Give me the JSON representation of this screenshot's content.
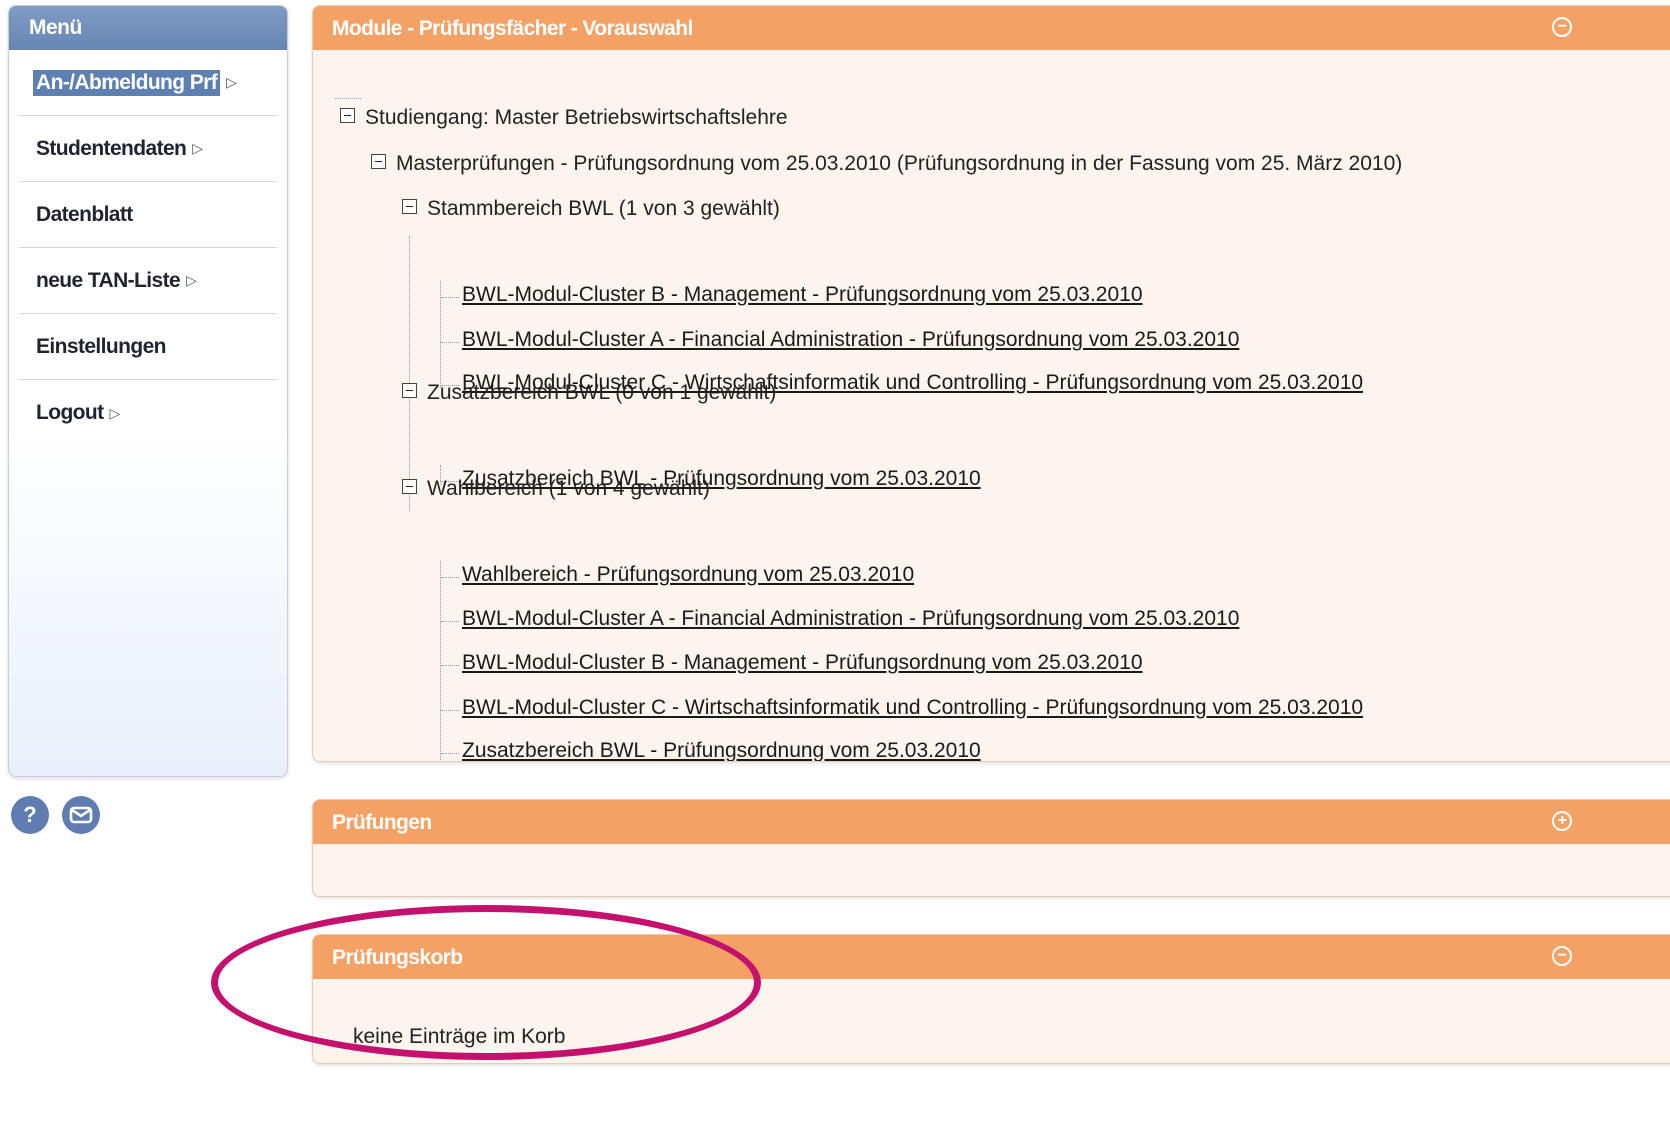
{
  "sidebar": {
    "title": "Menü",
    "items": [
      {
        "label": "An-/Abmeldung Prf",
        "arrow": "▷",
        "active": true
      },
      {
        "label": "Studentendaten",
        "arrow": "▷"
      },
      {
        "label": "Datenblatt",
        "arrow": ""
      },
      {
        "label": "neue TAN-Liste",
        "arrow": "▷"
      },
      {
        "label": "Einstellungen",
        "arrow": ""
      },
      {
        "label": "Logout",
        "arrow": "▷"
      }
    ],
    "help_icon_label": "?",
    "icons": [
      "help-icon",
      "mail-icon"
    ]
  },
  "panels": {
    "module": {
      "title": "Module - Prüfungsfächer - Vorauswahl",
      "toggle": "−",
      "tree": {
        "root": "Studiengang: Master Betriebswirtschaftslehre",
        "level1": "Masterprüfungen - Prüfungsordnung vom 25.03.2010 (Prüfungsordnung in der Fassung vom 25. März 2010)",
        "groups": [
          {
            "label": "Stammbereich BWL  (1 von 3 gewählt)",
            "items": [
              "BWL-Modul-Cluster B - Management - Prüfungsordnung vom 25.03.2010",
              "BWL-Modul-Cluster A - Financial Administration - Prüfungsordnung vom 25.03.2010",
              "BWL-Modul-Cluster C - Wirtschaftsinformatik und Controlling - Prüfungsordnung vom 25.03.2010"
            ]
          },
          {
            "label": "Zusatzbereich BWL  (0 von 1 gewählt)",
            "items": [
              "Zusatzbereich BWL - Prüfungsordnung vom 25.03.2010"
            ]
          },
          {
            "label": "Wahlbereich  (1 von 4 gewählt)",
            "items": [
              "Wahlbereich - Prüfungsordnung vom 25.03.2010",
              "BWL-Modul-Cluster A - Financial Administration - Prüfungsordnung vom 25.03.2010",
              "BWL-Modul-Cluster B - Management - Prüfungsordnung vom 25.03.2010",
              "BWL-Modul-Cluster C - Wirtschaftsinformatik und Controlling - Prüfungsordnung vom 25.03.2010",
              "Zusatzbereich BWL - Prüfungsordnung vom 25.03.2010"
            ]
          }
        ]
      }
    },
    "pruefungen": {
      "title": "Prüfungen",
      "toggle": "+"
    },
    "korb": {
      "title": "Prüfungskorb",
      "toggle": "−",
      "empty_text": "keine Einträge im Korb"
    }
  },
  "colors": {
    "panel_header": "#f4a166",
    "panel_body": "#fdf4ee",
    "sidebar_header": "#6886b3",
    "highlight_ellipse": "#c4116e"
  }
}
